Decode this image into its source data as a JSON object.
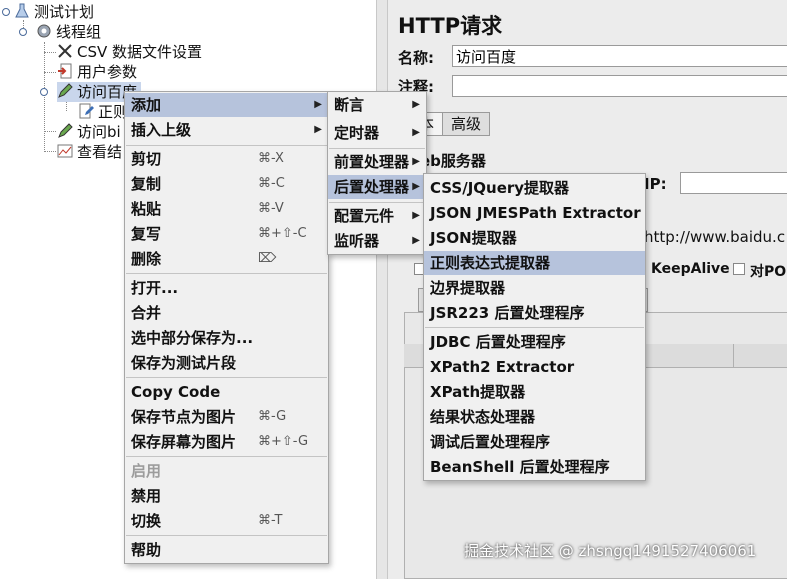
{
  "tree": {
    "root": "测试计划",
    "thread_group": "线程组",
    "csv": "CSV 数据文件设置",
    "user_params": "用户参数",
    "visit_baidu": "访问百度",
    "regex_child": "正则",
    "visit_bi": "访问bi",
    "view_results": "查看结"
  },
  "panel": {
    "title": "HTTP请求",
    "name_label": "名称:",
    "name_value": "访问百度",
    "comment_label": "注释:",
    "tab_basic_tail": "本",
    "tab_advanced": "高级",
    "web_server_partial": "eb服务器",
    "ip_label": "IP:",
    "url_partial": "http://www.baidu.c",
    "keepalive": "KeepAlive",
    "post_partial": "对POS"
  },
  "context_menu": {
    "items": [
      {
        "label": "添加",
        "shortcut": "",
        "submenu": true
      },
      {
        "label": "插入上级",
        "shortcut": "",
        "submenu": true
      },
      {
        "label": "剪切",
        "shortcut": "⌘-X"
      },
      {
        "label": "复制",
        "shortcut": "⌘-C"
      },
      {
        "label": "粘贴",
        "shortcut": "⌘-V"
      },
      {
        "label": "复写",
        "shortcut": "⌘+⇧-C"
      },
      {
        "label": "删除",
        "shortcut": "⌦"
      },
      {
        "label": "打开...",
        "shortcut": ""
      },
      {
        "label": "合并",
        "shortcut": ""
      },
      {
        "label": "选中部分保存为...",
        "shortcut": ""
      },
      {
        "label": "保存为测试片段",
        "shortcut": ""
      },
      {
        "label": "Copy Code",
        "shortcut": ""
      },
      {
        "label": "保存节点为图片",
        "shortcut": "⌘-G"
      },
      {
        "label": "保存屏幕为图片",
        "shortcut": "⌘+⇧-G"
      },
      {
        "label": "启用",
        "shortcut": ""
      },
      {
        "label": "禁用",
        "shortcut": ""
      },
      {
        "label": "切换",
        "shortcut": "⌘-T"
      },
      {
        "label": "帮助",
        "shortcut": ""
      }
    ]
  },
  "add_submenu": {
    "items": [
      {
        "label": "断言"
      },
      {
        "label": "定时器"
      },
      {
        "label": "前置处理器"
      },
      {
        "label": "后置处理器"
      },
      {
        "label": "配置元件"
      },
      {
        "label": "监听器"
      }
    ]
  },
  "post_processor_submenu": {
    "items": [
      {
        "label": "CSS/JQuery提取器"
      },
      {
        "label": "JSON JMESPath Extractor"
      },
      {
        "label": "JSON提取器"
      },
      {
        "label": "正则表达式提取器"
      },
      {
        "label": "边界提取器"
      },
      {
        "label": "JSR223 后置处理程序"
      },
      {
        "label": "JDBC 后置处理程序"
      },
      {
        "label": "XPath2 Extractor"
      },
      {
        "label": "XPath提取器"
      },
      {
        "label": "结果状态处理器"
      },
      {
        "label": "调试后置处理程序"
      },
      {
        "label": "BeanShell 后置处理程序"
      }
    ]
  },
  "watermark": "掘金技术社区 @ zhsngq1491527406061",
  "colors": {
    "highlight": "#b6c3dc",
    "menu_bg": "#f0f0f0",
    "panel_bg": "#ececec"
  }
}
